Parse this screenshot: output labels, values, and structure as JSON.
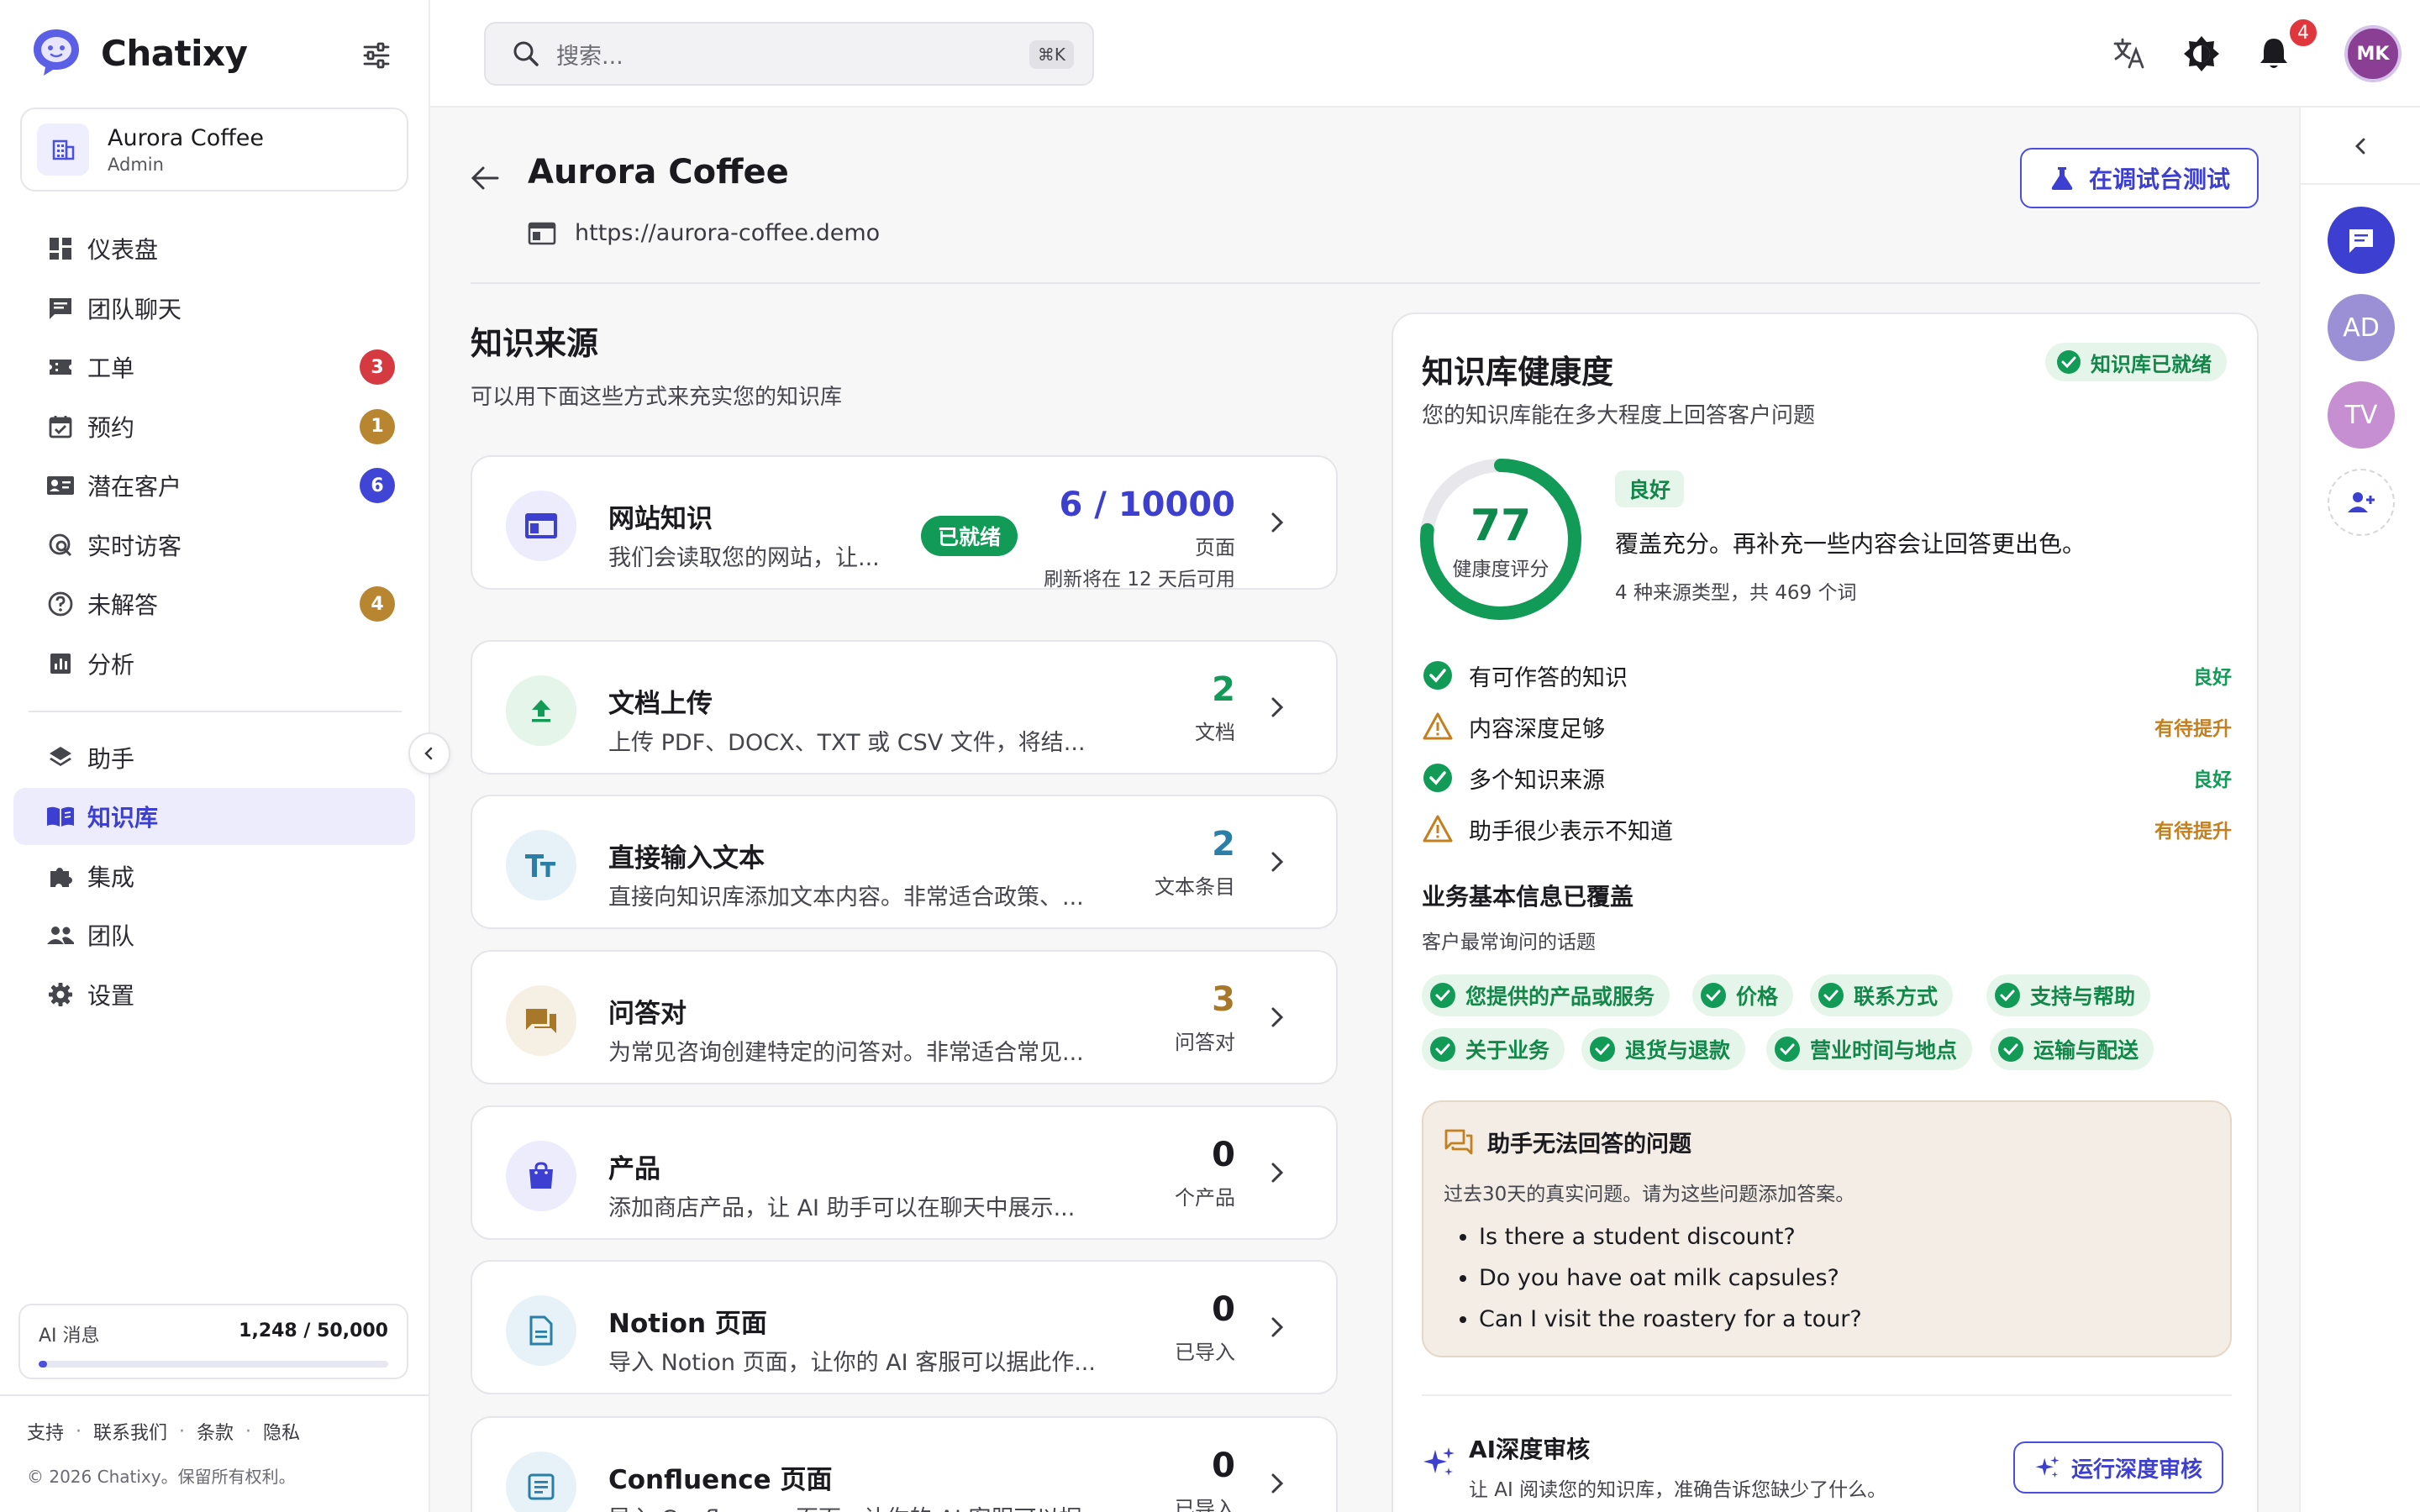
{
  "app": {
    "name": "Chatixy"
  },
  "org": {
    "name": "Aurora Coffee",
    "role": "Admin"
  },
  "nav": {
    "items": [
      {
        "label": "仪表盘"
      },
      {
        "label": "团队聊天"
      },
      {
        "label": "工单",
        "badge": "3"
      },
      {
        "label": "预约",
        "badge": "1"
      },
      {
        "label": "潜在客户",
        "badge": "6"
      },
      {
        "label": "实时访客"
      },
      {
        "label": "未解答",
        "badge": "4"
      },
      {
        "label": "分析"
      }
    ],
    "secondary": [
      {
        "label": "助手"
      },
      {
        "label": "知识库"
      },
      {
        "label": "集成"
      },
      {
        "label": "团队"
      },
      {
        "label": "设置"
      }
    ]
  },
  "usage": {
    "label": "AI 消息",
    "value": "1,248 / 50,000",
    "fraction": 0.025
  },
  "footer": {
    "links": [
      "支持",
      "联系我们",
      "条款",
      "隐私"
    ],
    "copyright": "© 2026 Chatixy。保留所有权利。"
  },
  "search": {
    "placeholder": "搜索...",
    "shortcut": "⌘K"
  },
  "topbar": {
    "notification_count": "4",
    "avatar_initials": "MK"
  },
  "rail": {
    "avatars": [
      "AD",
      "TV"
    ]
  },
  "page": {
    "title": "Aurora Coffee",
    "url": "https://aurora-coffee.demo",
    "test_button": "在调试台测试"
  },
  "knowledge_sources": {
    "title": "知识来源",
    "subtitle": "可以用下面这些方式来充实您的知识库",
    "cards": [
      {
        "title": "网站知识",
        "desc": "我们会读取您的网站，让...",
        "pill": "已就绪",
        "count": "6 / 10000",
        "unit": "页面",
        "note": "刷新将在 12 天后可用",
        "color": "#3d3fd0"
      },
      {
        "title": "文档上传",
        "desc": "上传 PDF、DOCX、TXT 或 CSV 文件，将结...",
        "count": "2",
        "unit": "文档",
        "color": "#129a57"
      },
      {
        "title": "直接输入文本",
        "desc": "直接向知识库添加文本内容。非常适合政策、...",
        "count": "2",
        "unit": "文本条目",
        "color": "#2a7fa8"
      },
      {
        "title": "问答对",
        "desc": "为常见咨询创建特定的问答对。非常适合常见...",
        "count": "3",
        "unit": "问答对",
        "color": "#a8782a"
      },
      {
        "title": "产品",
        "desc": "添加商店产品，让 AI 助手可以在聊天中展示...",
        "count": "0",
        "unit": "个产品",
        "color": "#1b1b1f"
      },
      {
        "title": "Notion 页面",
        "desc": "导入 Notion 页面，让你的 AI 客服可以据此作...",
        "count": "0",
        "unit": "已导入",
        "color": "#1b1b1f"
      },
      {
        "title": "Confluence 页面",
        "desc": "导入 Confluence 页面，让你的 AI 客服可以据...",
        "count": "0",
        "unit": "已导入",
        "color": "#1b1b1f"
      }
    ]
  },
  "health": {
    "title": "知识库健康度",
    "subtitle": "您的知识库能在多大程度上回答客户问题",
    "status": "知识库已就绪",
    "score": "77",
    "score_value": 77,
    "score_label": "健康度评分",
    "grade": "良好",
    "summary": "覆盖充分。再补充一些内容会让回答更出色。",
    "meta": "4 种来源类型，共 469 个词",
    "checks": [
      {
        "label": "有可作答的知识",
        "status": "良好",
        "ok": true
      },
      {
        "label": "内容深度足够",
        "status": "有待提升",
        "ok": false
      },
      {
        "label": "多个知识来源",
        "status": "良好",
        "ok": true
      },
      {
        "label": "助手很少表示不知道",
        "status": "有待提升",
        "ok": false
      }
    ],
    "business": {
      "title": "业务基本信息已覆盖",
      "subtitle": "客户最常询问的话题",
      "tags": [
        "您提供的产品或服务",
        "价格",
        "联系方式",
        "支持与帮助",
        "关于业务",
        "退货与退款",
        "营业时间与地点",
        "运输与配送"
      ]
    },
    "unanswered": {
      "title": "助手无法回答的问题",
      "subtitle": "过去30天的真实问题。请为这些问题添加答案。",
      "questions": [
        "Is there a student discount?",
        "Do you have oat milk capsules?",
        "Can I visit the roastery for a tour?"
      ]
    },
    "audit": {
      "title": "AI深度审核",
      "subtitle": "让 AI 阅读您的知识库，准确告诉您缺少了什么。",
      "button": "运行深度审核"
    }
  },
  "colors": {
    "accent": "#4b4fe0",
    "success": "#129a57",
    "warning": "#c47f1e",
    "danger": "#e0363d"
  }
}
